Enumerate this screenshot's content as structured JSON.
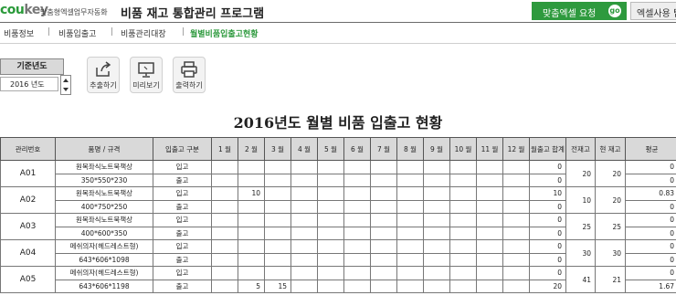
{
  "header": {
    "logo_main": "cou",
    "logo_key": "key",
    "logo_sub": "맞춤형엑셀업무자동화",
    "title": "비품 재고 통합관리 프로그램",
    "custom_request": "맞춤엑셀 요청",
    "go": "go",
    "guide": "엑셀사용 팁"
  },
  "menu": {
    "items": [
      "비품정보",
      "비품입출고",
      "비품관리대장",
      "월별비품입출고현황"
    ],
    "separator": "|"
  },
  "controls": {
    "year_label": "기준년도",
    "year_value": "2016 년도",
    "buttons": [
      {
        "label": "추출하기",
        "icon": "export-icon"
      },
      {
        "label": "미리보기",
        "icon": "monitor-icon"
      },
      {
        "label": "출력하기",
        "icon": "printer-icon"
      }
    ]
  },
  "report": {
    "title": "2016년도 월별 비품 입출고 현황",
    "columns": [
      "관리번호",
      "품명 / 규격",
      "입출고 구분",
      "1 월",
      "2 월",
      "3 월",
      "4 월",
      "5 월",
      "6 월",
      "7 월",
      "8 월",
      "9 월",
      "10 월",
      "11 월",
      "12 월",
      "월출고 합계",
      "전재고",
      "현 재고",
      "평균"
    ],
    "items": [
      {
        "id": "A01",
        "name": "원목좌식노트북책상",
        "spec": "350*550*230",
        "in": {
          "months": [
            "",
            "",
            "",
            "",
            "",
            "",
            "",
            "",
            "",
            "",
            "",
            ""
          ],
          "total": "0",
          "avg": "0"
        },
        "out": {
          "months": [
            "",
            "",
            "",
            "",
            "",
            "",
            "",
            "",
            "",
            "",
            "",
            ""
          ],
          "total": "0",
          "avg": "0"
        },
        "prev": "20",
        "current": "20"
      },
      {
        "id": "A02",
        "name": "원목좌식노트북책상",
        "spec": "400*750*250",
        "in": {
          "months": [
            "",
            "10",
            "",
            "",
            "",
            "",
            "",
            "",
            "",
            "",
            "",
            ""
          ],
          "total": "10",
          "avg": "0.83"
        },
        "out": {
          "months": [
            "",
            "",
            "",
            "",
            "",
            "",
            "",
            "",
            "",
            "",
            "",
            ""
          ],
          "total": "0",
          "avg": "0"
        },
        "prev": "10",
        "current": "20"
      },
      {
        "id": "A03",
        "name": "원목좌식노트북책상",
        "spec": "400*600*350",
        "in": {
          "months": [
            "",
            "",
            "",
            "",
            "",
            "",
            "",
            "",
            "",
            "",
            "",
            ""
          ],
          "total": "0",
          "avg": "0"
        },
        "out": {
          "months": [
            "",
            "",
            "",
            "",
            "",
            "",
            "",
            "",
            "",
            "",
            "",
            ""
          ],
          "total": "0",
          "avg": "0"
        },
        "prev": "25",
        "current": "25"
      },
      {
        "id": "A04",
        "name": "메쉬의자(헤드레스트형)",
        "spec": "643*606*1098",
        "in": {
          "months": [
            "",
            "",
            "",
            "",
            "",
            "",
            "",
            "",
            "",
            "",
            "",
            ""
          ],
          "total": "0",
          "avg": "0"
        },
        "out": {
          "months": [
            "",
            "",
            "",
            "",
            "",
            "",
            "",
            "",
            "",
            "",
            "",
            ""
          ],
          "total": "0",
          "avg": "0"
        },
        "prev": "30",
        "current": "30"
      },
      {
        "id": "A05",
        "name": "메쉬의자(헤드레스트형)",
        "spec": "643*606*1198",
        "in": {
          "months": [
            "",
            "",
            "",
            "",
            "",
            "",
            "",
            "",
            "",
            "",
            "",
            ""
          ],
          "total": "0",
          "avg": "0"
        },
        "out": {
          "months": [
            "",
            "5",
            "15",
            "",
            "",
            "",
            "",
            "",
            "",
            "",
            "",
            ""
          ],
          "total": "20",
          "avg": "1.67"
        },
        "prev": "41",
        "current": "21"
      }
    ],
    "in_label": "입고",
    "out_label": "출고"
  },
  "colors": {
    "accent": "#2e9a3e",
    "header_bg": "#d9d9d9"
  }
}
